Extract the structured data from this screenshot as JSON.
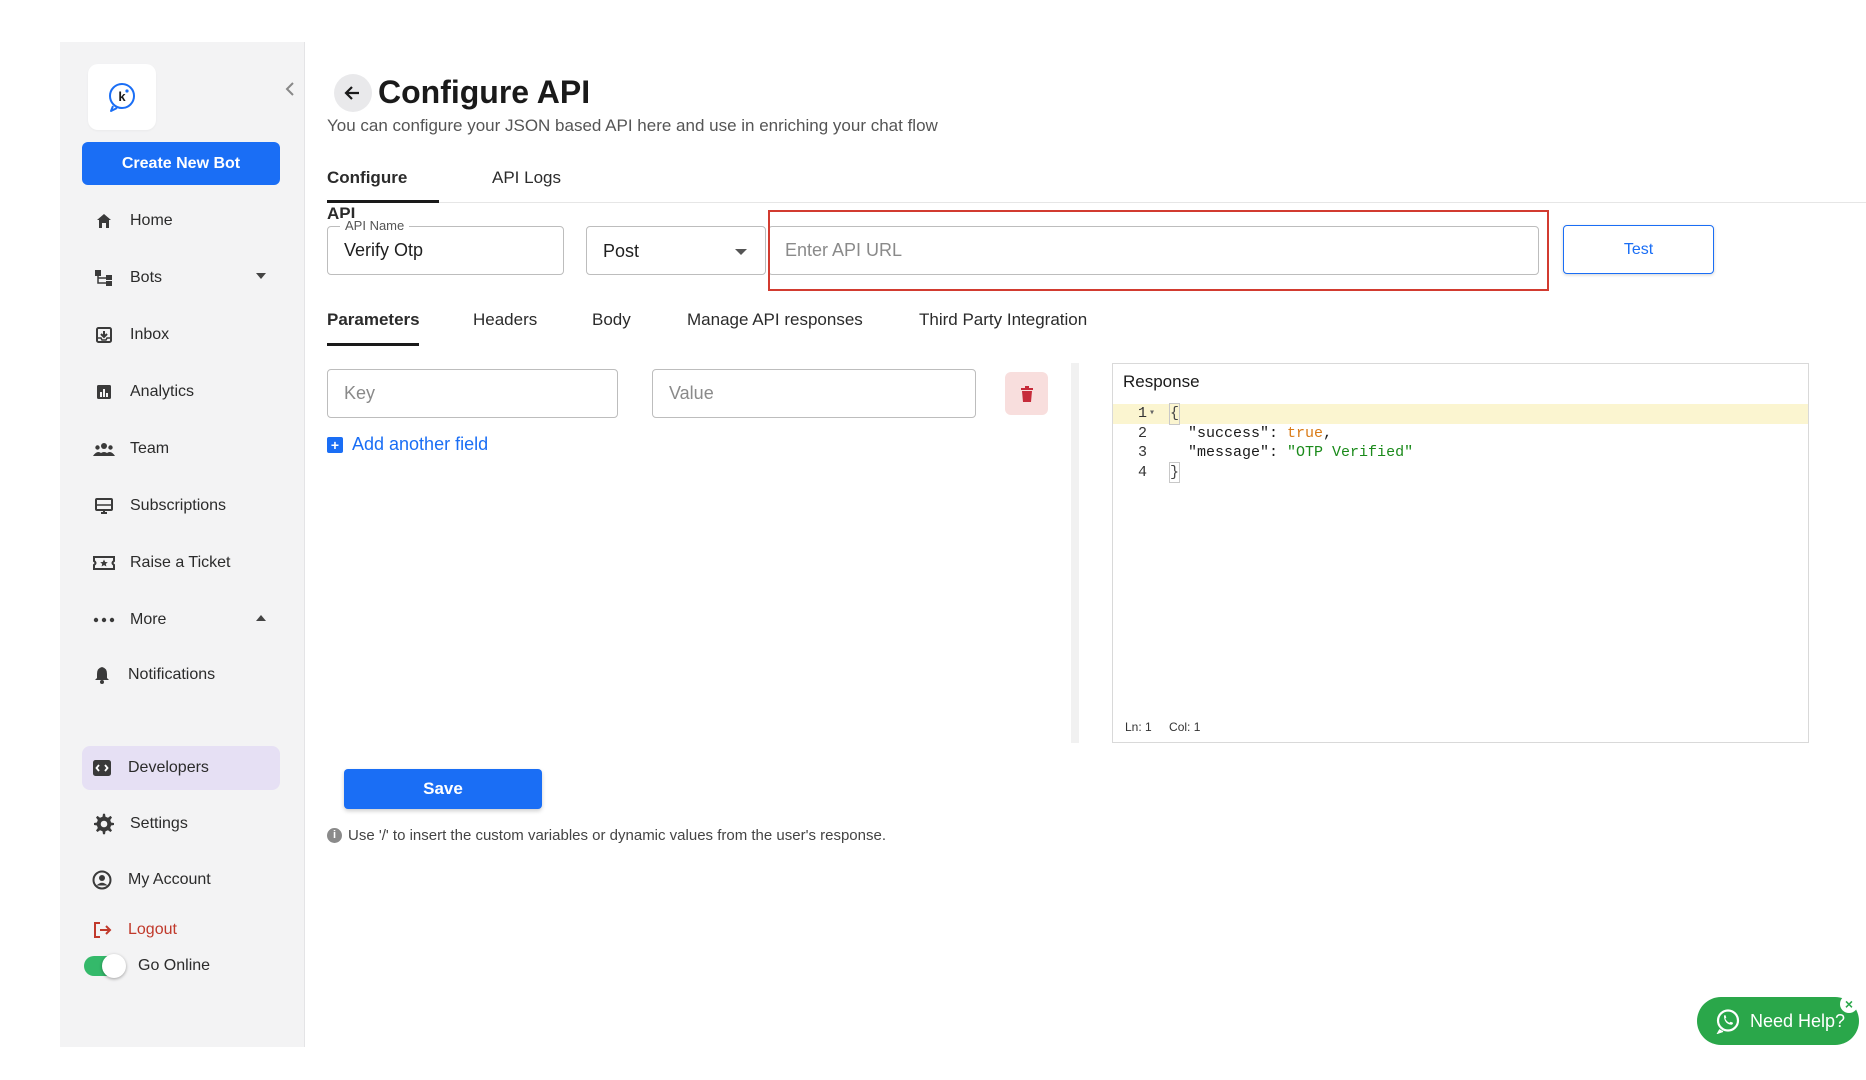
{
  "sidebar": {
    "create_button": "Create New Bot",
    "items": [
      {
        "label": "Home",
        "icon": "home-icon"
      },
      {
        "label": "Bots",
        "icon": "bots-icon"
      },
      {
        "label": "Inbox",
        "icon": "inbox-icon"
      },
      {
        "label": "Analytics",
        "icon": "analytics-icon"
      },
      {
        "label": "Team",
        "icon": "team-icon"
      },
      {
        "label": "Subscriptions",
        "icon": "subscriptions-icon"
      },
      {
        "label": "Raise a Ticket",
        "icon": "ticket-icon"
      },
      {
        "label": "More",
        "icon": "more-icon"
      },
      {
        "label": "Notifications",
        "icon": "bell-icon"
      },
      {
        "label": "Developers",
        "icon": "code-icon"
      },
      {
        "label": "Settings",
        "icon": "gear-icon"
      },
      {
        "label": "My Account",
        "icon": "account-icon"
      },
      {
        "label": "Logout",
        "icon": "logout-icon"
      }
    ],
    "go_online": "Go Online",
    "go_online_state": true,
    "active_item": "Developers"
  },
  "header": {
    "title": "Configure API",
    "subtitle": "You can configure your JSON based API here and use in enriching your chat flow"
  },
  "tabs": [
    "Configure API",
    "API Logs"
  ],
  "api_form": {
    "name_label": "API Name",
    "name_value": "Verify Otp",
    "method": "Post",
    "url_placeholder": "Enter API URL",
    "url_value": "",
    "test_button": "Test"
  },
  "sub_tabs": [
    "Parameters",
    "Headers",
    "Body",
    "Manage API responses",
    "Third Party Integration"
  ],
  "parameters": {
    "key_placeholder": "Key",
    "value_placeholder": "Value",
    "add_field": "Add another field"
  },
  "response": {
    "title": "Response",
    "line_numbers": [
      "1",
      "2",
      "3",
      "4"
    ],
    "open_brace": "{",
    "close_brace": "}",
    "key_success": "\"success\"",
    "val_success": "true",
    "key_message": "\"message\"",
    "val_message": "\"OTP Verified\"",
    "status_ln": "Ln: 1",
    "status_col": "Col: 1"
  },
  "save_button": "Save",
  "hint": "Use '/' to insert the custom variables or dynamic values from the user's response.",
  "need_help": "Need Help?",
  "colors": {
    "accent": "#1a6ef5",
    "danger": "#d23b30",
    "whatsapp": "#2aa74a",
    "active_nav_bg": "#e6e0f4"
  }
}
